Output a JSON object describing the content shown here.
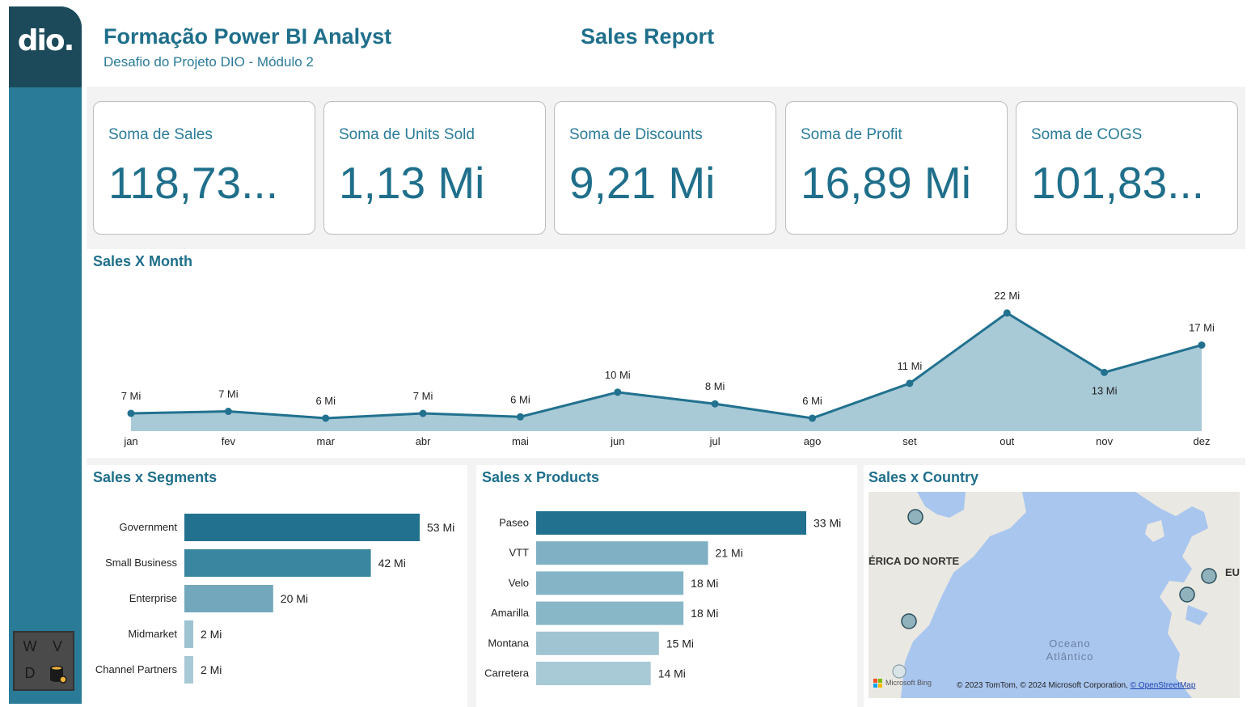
{
  "logo": {
    "text": "dio."
  },
  "header": {
    "title": "Formação Power BI Analyst",
    "subtitle": "Desafio do Projeto DIO - Módulo 2",
    "report_title": "Sales Report"
  },
  "badge": {
    "letters": [
      "W",
      "V",
      "D",
      ""
    ],
    "colors": [
      "#e8573a",
      "#8dbb3b",
      "#2a8fd6",
      "#f2b43a"
    ]
  },
  "kpis": [
    {
      "label": "Soma de Sales",
      "value": "118,73..."
    },
    {
      "label": "Soma de Units Sold",
      "value": "1,13 Mi"
    },
    {
      "label": "Soma de Discounts",
      "value": "9,21 Mi"
    },
    {
      "label": "Soma de Profit",
      "value": "16,89 Mi"
    },
    {
      "label": "Soma de COGS",
      "value": "101,83..."
    }
  ],
  "sections": {
    "month": "Sales X Month",
    "segments": "Sales x Segments",
    "products": "Sales x Products",
    "country": "Sales x Country"
  },
  "colors": {
    "accent": "#1f6f8b",
    "area": "#a8c9d6",
    "line": "#21718f"
  },
  "chart_data": [
    {
      "type": "area",
      "title": "Sales X Month",
      "categories": [
        "jan",
        "fev",
        "mar",
        "abr",
        "mai",
        "jun",
        "jul",
        "ago",
        "set",
        "out",
        "nov",
        "dez"
      ],
      "values": [
        7.1,
        7.4,
        6.4,
        7.1,
        6.6,
        10.2,
        8.5,
        6.4,
        11.5,
        21.8,
        13.1,
        17.1
      ],
      "labels": [
        "7 Mi",
        "7 Mi",
        "6 Mi",
        "7 Mi",
        "6 Mi",
        "10 Mi",
        "8 Mi",
        "6 Mi",
        "11 Mi",
        "22 Mi",
        "13 Mi",
        "17 Mi"
      ],
      "ylim": [
        4.5,
        22.5
      ],
      "grid": false,
      "unit": "Mi"
    },
    {
      "type": "bar",
      "title": "Sales x Segments",
      "orientation": "horizontal",
      "categories": [
        "Government",
        "Small Business",
        "Enterprise",
        "Midmarket",
        "Channel Partners"
      ],
      "values": [
        53,
        42,
        20,
        2,
        2
      ],
      "labels": [
        "53 Mi",
        "42 Mi",
        "20 Mi",
        "2 Mi",
        "2 Mi"
      ],
      "colors": [
        "#21718f",
        "#3a86a1",
        "#73a8bc",
        "#9dc2d0",
        "#a8c9d6"
      ],
      "xlim": [
        0,
        53
      ]
    },
    {
      "type": "bar",
      "title": "Sales x Products",
      "orientation": "horizontal",
      "categories": [
        "Paseo",
        "VTT",
        "Velo",
        "Amarilla",
        "Montana",
        "Carretera"
      ],
      "values": [
        33,
        21,
        18,
        18,
        15,
        14
      ],
      "labels": [
        "33 Mi",
        "21 Mi",
        "18 Mi",
        "18 Mi",
        "15 Mi",
        "14 Mi"
      ],
      "colors": [
        "#21718f",
        "#7fb0c3",
        "#84b4c6",
        "#88b7c8",
        "#a0c4d2",
        "#a8c9d6"
      ],
      "xlim": [
        0,
        33
      ]
    }
  ],
  "map": {
    "label_na": "ÉRICA DO NORTE",
    "label_eu": "EU",
    "ocean": "Oceano Atlântico",
    "ocean_line1": "Oceano",
    "ocean_line2": "Atlântico",
    "bing": "Microsoft Bing",
    "copyright": "© 2023 TomTom, © 2024 Microsoft Corporation,",
    "osm": "© OpenStreetMap"
  }
}
